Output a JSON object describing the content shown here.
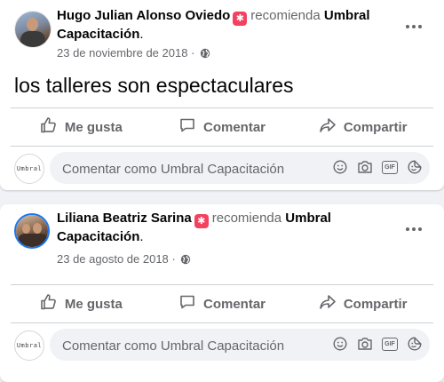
{
  "posts": [
    {
      "author": "Hugo Julian Alonso Oviedo",
      "recommends_word": "recomienda",
      "page_name": "Umbral Capacitación",
      "date": "23 de noviembre de 2018",
      "dot": " · ",
      "text": "los talleres son espectaculares",
      "actions": {
        "like": "Me gusta",
        "comment": "Comentar",
        "share": "Compartir"
      },
      "comment_placeholder": "Comentar como Umbral Capacitación"
    },
    {
      "author": "Liliana Beatriz Sarina",
      "recommends_word": "recomienda",
      "page_name": "Umbral Capacitación",
      "date": "23 de agosto de 2018",
      "dot": " · ",
      "actions": {
        "like": "Me gusta",
        "comment": "Comentar",
        "share": "Compartir"
      },
      "comment_placeholder": "Comentar como Umbral Capacitación"
    }
  ],
  "commenter_avatar_text": "Umbral",
  "comment_icons": [
    "emoji-icon",
    "camera-icon",
    "gif-icon",
    "sticker-icon"
  ],
  "gif_label": "GIF",
  "colors": {
    "recommend": "#f3425f",
    "secondary_text": "#65676b",
    "ring": "#1877f2",
    "background": "#f0f2f5"
  }
}
